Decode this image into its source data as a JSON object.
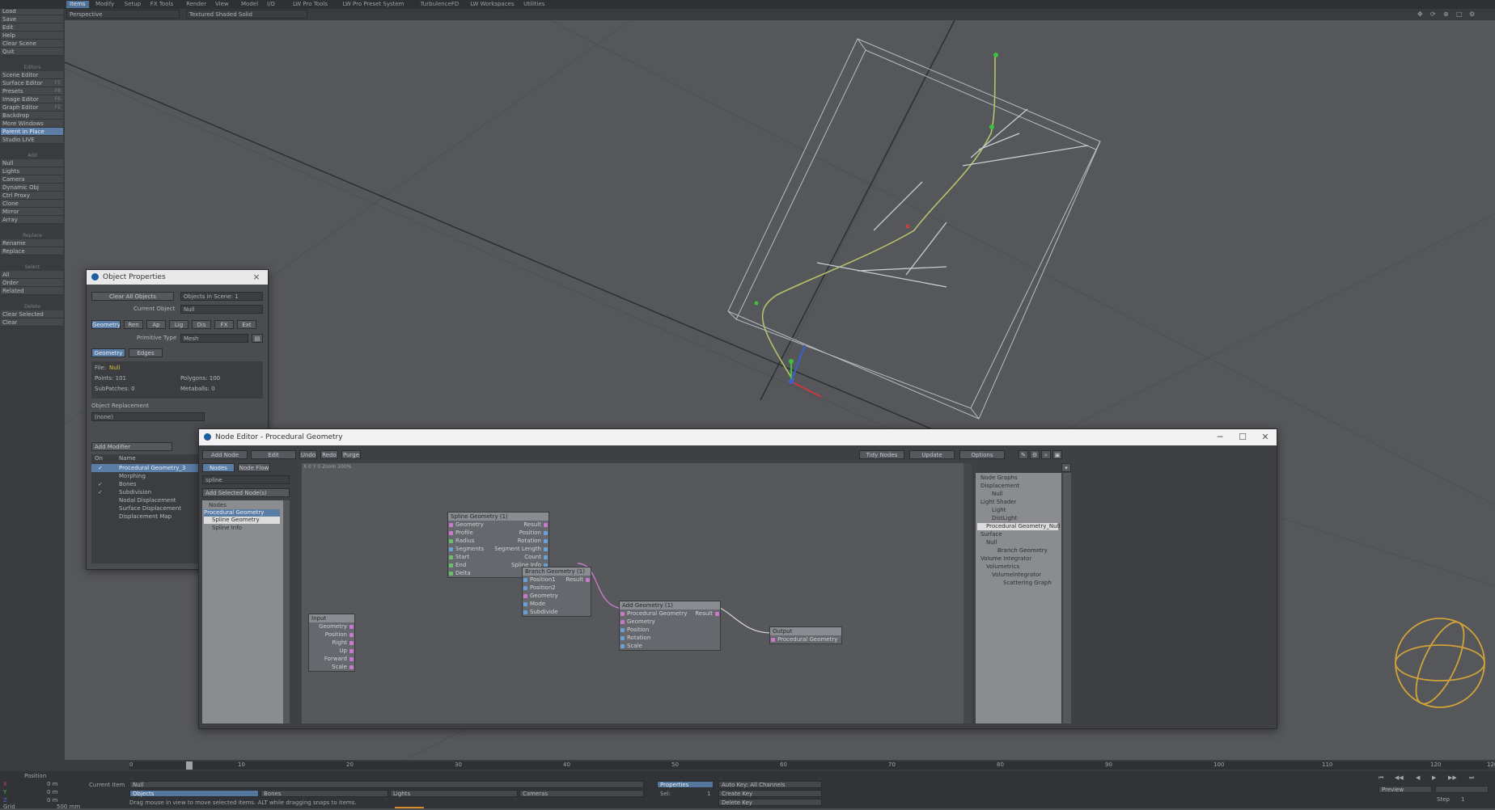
{
  "app": {
    "top_tabs": [
      "Items",
      "Modify",
      "Setup",
      "FX Tools",
      "Render",
      "View",
      "Model",
      "I/O",
      "LW Pro Tools",
      "LW Pro Preset System",
      "TurbulenceFD",
      "LW Workspaces",
      "Utilities"
    ],
    "active_top_tab": 0,
    "viewport_mode": "Perspective",
    "shading_mode": "Textured Shaded Solid"
  },
  "leftbar": {
    "sections": [
      {
        "head": "File",
        "items": [
          {
            "label": "Load",
            "key": ""
          },
          {
            "label": "Save",
            "key": ""
          },
          {
            "label": "Edit",
            "key": ""
          },
          {
            "label": "Help",
            "key": ""
          },
          {
            "label": "Clear Scene",
            "key": ""
          },
          {
            "label": "Quit",
            "key": ""
          }
        ]
      },
      {
        "head": "Editors",
        "items": [
          {
            "label": "Scene Editor",
            "key": ""
          },
          {
            "label": "Surface Editor",
            "key": "F5"
          },
          {
            "label": "Presets",
            "key": "F8"
          },
          {
            "label": "Image Editor",
            "key": "F6"
          },
          {
            "label": "Graph Editor",
            "key": "F2"
          },
          {
            "label": "Backdrop",
            "key": ""
          },
          {
            "label": "More Windows",
            "key": ""
          },
          {
            "label": "Parent in Place",
            "key": ""
          },
          {
            "label": "Studio LIVE",
            "key": ""
          }
        ]
      },
      {
        "head": "Add",
        "items": [
          {
            "label": "Null",
            "key": ""
          },
          {
            "label": "Lights",
            "key": ""
          },
          {
            "label": "Camera",
            "key": ""
          },
          {
            "label": "Dynamic Obj",
            "key": ""
          },
          {
            "label": "Ctrl Proxy",
            "key": ""
          },
          {
            "label": "Clone",
            "key": ""
          },
          {
            "label": "Mirror",
            "key": ""
          },
          {
            "label": "Array",
            "key": ""
          }
        ]
      },
      {
        "head": "Replace",
        "items": [
          {
            "label": "Rename",
            "key": ""
          },
          {
            "label": "Replace",
            "key": ""
          }
        ]
      },
      {
        "head": "Select",
        "items": [
          {
            "label": "All",
            "key": ""
          },
          {
            "label": "Order",
            "key": ""
          },
          {
            "label": "Related",
            "key": ""
          }
        ]
      },
      {
        "head": "Delete",
        "items": [
          {
            "label": "Clear Selected",
            "key": ""
          },
          {
            "label": "Clear",
            "key": ""
          }
        ]
      }
    ],
    "position_label": "Position"
  },
  "object_properties": {
    "title": "Object Properties",
    "clear_all_objects": "Clear All Objects",
    "objects_in_scene": "Objects in Scene: 1",
    "current_object_label": "Current Object",
    "current_object_value": "Null",
    "tabs": [
      "Geometry",
      "Ren",
      "Ap",
      "Lig",
      "Dis",
      "FX",
      "Ext"
    ],
    "primitive_type_label": "Primitive Type",
    "primitive_type_value": "Mesh",
    "subtabs": [
      "Geometry",
      "Edges"
    ],
    "file_label": "File:",
    "file_value": "Null",
    "points": "Points: 101",
    "polygons": "Polygons: 100",
    "subpatches": "SubPatches: 0",
    "metaballs": "Metaballs: 0",
    "object_replacement": "Object Replacement",
    "replacement_value": "(none)",
    "add_modifier": "Add Modifier",
    "mod_headers": [
      "On",
      "Name"
    ],
    "modifiers": [
      {
        "on": "✓",
        "name": "Procedural Geometry_3"
      },
      {
        "on": "",
        "name": "Morphing"
      },
      {
        "on": "✓",
        "name": "Bones"
      },
      {
        "on": "✓",
        "name": "Subdivision"
      },
      {
        "on": "",
        "name": "Nodal Displacement"
      },
      {
        "on": "",
        "name": "Surface Displacement"
      },
      {
        "on": "",
        "name": "Displacement Map"
      }
    ]
  },
  "node_editor": {
    "title": "Node Editor - Procedural Geometry",
    "toolbar": [
      "Add Node",
      "Edit",
      "Undo",
      "Redo",
      "Purge"
    ],
    "toolbar_right": [
      "Tidy Nodes",
      "Update",
      "Options"
    ],
    "status": "X 0 Y 0 Zoom 100%",
    "left_tabs": [
      "Nodes",
      "Node Flow"
    ],
    "search_value": "spline",
    "add_selected": "Add Selected Node(s)",
    "tree": [
      "Nodes",
      "Procedural Geometry",
      "Spline Geometry",
      "Spline Info"
    ],
    "nodes": {
      "spline_geometry": {
        "title": "Spline Geometry (1)",
        "inputs": [
          "Geometry",
          "Profile",
          "Radius",
          "Segments",
          "Start",
          "End",
          "Delta"
        ],
        "outputs": [
          "Result",
          "Position",
          "Rotation",
          "Segment Length",
          "Count",
          "Spline Info"
        ]
      },
      "branch": {
        "title": "Branch Geometry (1)",
        "rows": [
          "Position1",
          "Position2",
          "Geometry",
          "Mode",
          "Subdivide"
        ],
        "output": "Result"
      },
      "input": {
        "title": "Input",
        "rows": [
          "Geometry",
          "Position",
          "Right",
          "Up",
          "Forward",
          "Scale"
        ]
      },
      "add_geometry": {
        "title": "Add Geometry (1)",
        "rows": [
          "Procedural Geometry",
          "Geometry",
          "Position",
          "Rotation",
          "Scale"
        ],
        "output": "Result"
      },
      "output": {
        "title": "Output",
        "rows": [
          "Procedural Geometry"
        ]
      }
    },
    "graph_tree": [
      {
        "label": "Node Graphs",
        "indent": 0
      },
      {
        "label": "Displacement",
        "indent": 0
      },
      {
        "label": "Null",
        "indent": 2
      },
      {
        "label": "Light Shader",
        "indent": 0
      },
      {
        "label": "Light",
        "indent": 2
      },
      {
        "label": "DistLight",
        "indent": 2
      },
      {
        "label": "Procedural Geometry_Null",
        "indent": 1
      },
      {
        "label": "Surface",
        "indent": 0
      },
      {
        "label": "Null",
        "indent": 1
      },
      {
        "label": "Branch Geometry",
        "indent": 3
      },
      {
        "label": "Volume Integrator",
        "indent": 0
      },
      {
        "label": "Volumetrics",
        "indent": 1
      },
      {
        "label": "VolumeIntegrator",
        "indent": 2
      },
      {
        "label": "Scattering Graph",
        "indent": 4
      }
    ]
  },
  "timeline": {
    "ticks": [
      "0",
      "10",
      "20",
      "30",
      "40",
      "50",
      "60",
      "70",
      "80",
      "90",
      "100",
      "110",
      "120",
      "120"
    ]
  },
  "bottom": {
    "xyz": [
      "0 m",
      "0 m",
      "0 m"
    ],
    "grid": "500 mm",
    "grid_label": "Grid",
    "current_item_label": "Current Item",
    "current_item_value": "Null",
    "filters": [
      "Objects",
      "Bones",
      "Lights",
      "Cameras"
    ],
    "properties": "Properties",
    "sel_label": "Sel:",
    "sel_value": "1",
    "auto_key": "Auto Key: All Channels",
    "create_key": "Create Key",
    "delete_key": "Delete Key",
    "hint": "Drag mouse in view to move selected items. ALT while dragging snaps to items.",
    "preview": "Preview",
    "step_label": "Step",
    "step_value": "1"
  }
}
